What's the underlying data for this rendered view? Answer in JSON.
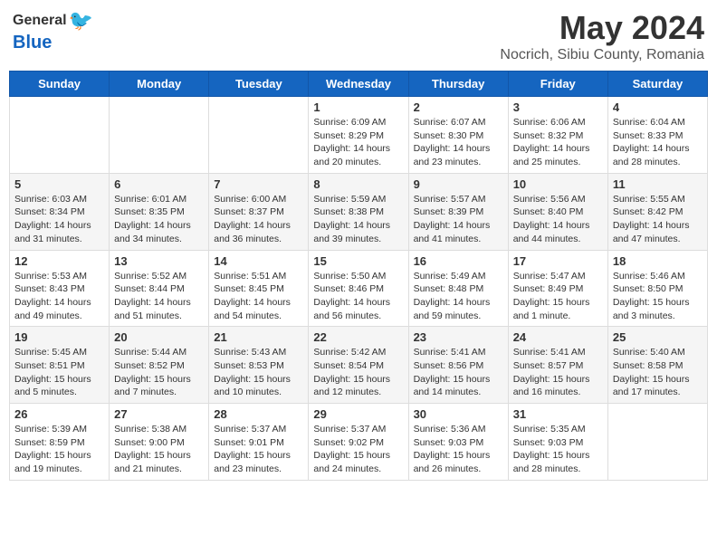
{
  "header": {
    "logo_general": "General",
    "logo_blue": "Blue",
    "month_year": "May 2024",
    "location": "Nocrich, Sibiu County, Romania"
  },
  "days_of_week": [
    "Sunday",
    "Monday",
    "Tuesday",
    "Wednesday",
    "Thursday",
    "Friday",
    "Saturday"
  ],
  "weeks": [
    [
      {
        "day": "",
        "info": ""
      },
      {
        "day": "",
        "info": ""
      },
      {
        "day": "",
        "info": ""
      },
      {
        "day": "1",
        "info": "Sunrise: 6:09 AM\nSunset: 8:29 PM\nDaylight: 14 hours\nand 20 minutes."
      },
      {
        "day": "2",
        "info": "Sunrise: 6:07 AM\nSunset: 8:30 PM\nDaylight: 14 hours\nand 23 minutes."
      },
      {
        "day": "3",
        "info": "Sunrise: 6:06 AM\nSunset: 8:32 PM\nDaylight: 14 hours\nand 25 minutes."
      },
      {
        "day": "4",
        "info": "Sunrise: 6:04 AM\nSunset: 8:33 PM\nDaylight: 14 hours\nand 28 minutes."
      }
    ],
    [
      {
        "day": "5",
        "info": "Sunrise: 6:03 AM\nSunset: 8:34 PM\nDaylight: 14 hours\nand 31 minutes."
      },
      {
        "day": "6",
        "info": "Sunrise: 6:01 AM\nSunset: 8:35 PM\nDaylight: 14 hours\nand 34 minutes."
      },
      {
        "day": "7",
        "info": "Sunrise: 6:00 AM\nSunset: 8:37 PM\nDaylight: 14 hours\nand 36 minutes."
      },
      {
        "day": "8",
        "info": "Sunrise: 5:59 AM\nSunset: 8:38 PM\nDaylight: 14 hours\nand 39 minutes."
      },
      {
        "day": "9",
        "info": "Sunrise: 5:57 AM\nSunset: 8:39 PM\nDaylight: 14 hours\nand 41 minutes."
      },
      {
        "day": "10",
        "info": "Sunrise: 5:56 AM\nSunset: 8:40 PM\nDaylight: 14 hours\nand 44 minutes."
      },
      {
        "day": "11",
        "info": "Sunrise: 5:55 AM\nSunset: 8:42 PM\nDaylight: 14 hours\nand 47 minutes."
      }
    ],
    [
      {
        "day": "12",
        "info": "Sunrise: 5:53 AM\nSunset: 8:43 PM\nDaylight: 14 hours\nand 49 minutes."
      },
      {
        "day": "13",
        "info": "Sunrise: 5:52 AM\nSunset: 8:44 PM\nDaylight: 14 hours\nand 51 minutes."
      },
      {
        "day": "14",
        "info": "Sunrise: 5:51 AM\nSunset: 8:45 PM\nDaylight: 14 hours\nand 54 minutes."
      },
      {
        "day": "15",
        "info": "Sunrise: 5:50 AM\nSunset: 8:46 PM\nDaylight: 14 hours\nand 56 minutes."
      },
      {
        "day": "16",
        "info": "Sunrise: 5:49 AM\nSunset: 8:48 PM\nDaylight: 14 hours\nand 59 minutes."
      },
      {
        "day": "17",
        "info": "Sunrise: 5:47 AM\nSunset: 8:49 PM\nDaylight: 15 hours\nand 1 minute."
      },
      {
        "day": "18",
        "info": "Sunrise: 5:46 AM\nSunset: 8:50 PM\nDaylight: 15 hours\nand 3 minutes."
      }
    ],
    [
      {
        "day": "19",
        "info": "Sunrise: 5:45 AM\nSunset: 8:51 PM\nDaylight: 15 hours\nand 5 minutes."
      },
      {
        "day": "20",
        "info": "Sunrise: 5:44 AM\nSunset: 8:52 PM\nDaylight: 15 hours\nand 7 minutes."
      },
      {
        "day": "21",
        "info": "Sunrise: 5:43 AM\nSunset: 8:53 PM\nDaylight: 15 hours\nand 10 minutes."
      },
      {
        "day": "22",
        "info": "Sunrise: 5:42 AM\nSunset: 8:54 PM\nDaylight: 15 hours\nand 12 minutes."
      },
      {
        "day": "23",
        "info": "Sunrise: 5:41 AM\nSunset: 8:56 PM\nDaylight: 15 hours\nand 14 minutes."
      },
      {
        "day": "24",
        "info": "Sunrise: 5:41 AM\nSunset: 8:57 PM\nDaylight: 15 hours\nand 16 minutes."
      },
      {
        "day": "25",
        "info": "Sunrise: 5:40 AM\nSunset: 8:58 PM\nDaylight: 15 hours\nand 17 minutes."
      }
    ],
    [
      {
        "day": "26",
        "info": "Sunrise: 5:39 AM\nSunset: 8:59 PM\nDaylight: 15 hours\nand 19 minutes."
      },
      {
        "day": "27",
        "info": "Sunrise: 5:38 AM\nSunset: 9:00 PM\nDaylight: 15 hours\nand 21 minutes."
      },
      {
        "day": "28",
        "info": "Sunrise: 5:37 AM\nSunset: 9:01 PM\nDaylight: 15 hours\nand 23 minutes."
      },
      {
        "day": "29",
        "info": "Sunrise: 5:37 AM\nSunset: 9:02 PM\nDaylight: 15 hours\nand 24 minutes."
      },
      {
        "day": "30",
        "info": "Sunrise: 5:36 AM\nSunset: 9:03 PM\nDaylight: 15 hours\nand 26 minutes."
      },
      {
        "day": "31",
        "info": "Sunrise: 5:35 AM\nSunset: 9:03 PM\nDaylight: 15 hours\nand 28 minutes."
      },
      {
        "day": "",
        "info": ""
      }
    ]
  ]
}
